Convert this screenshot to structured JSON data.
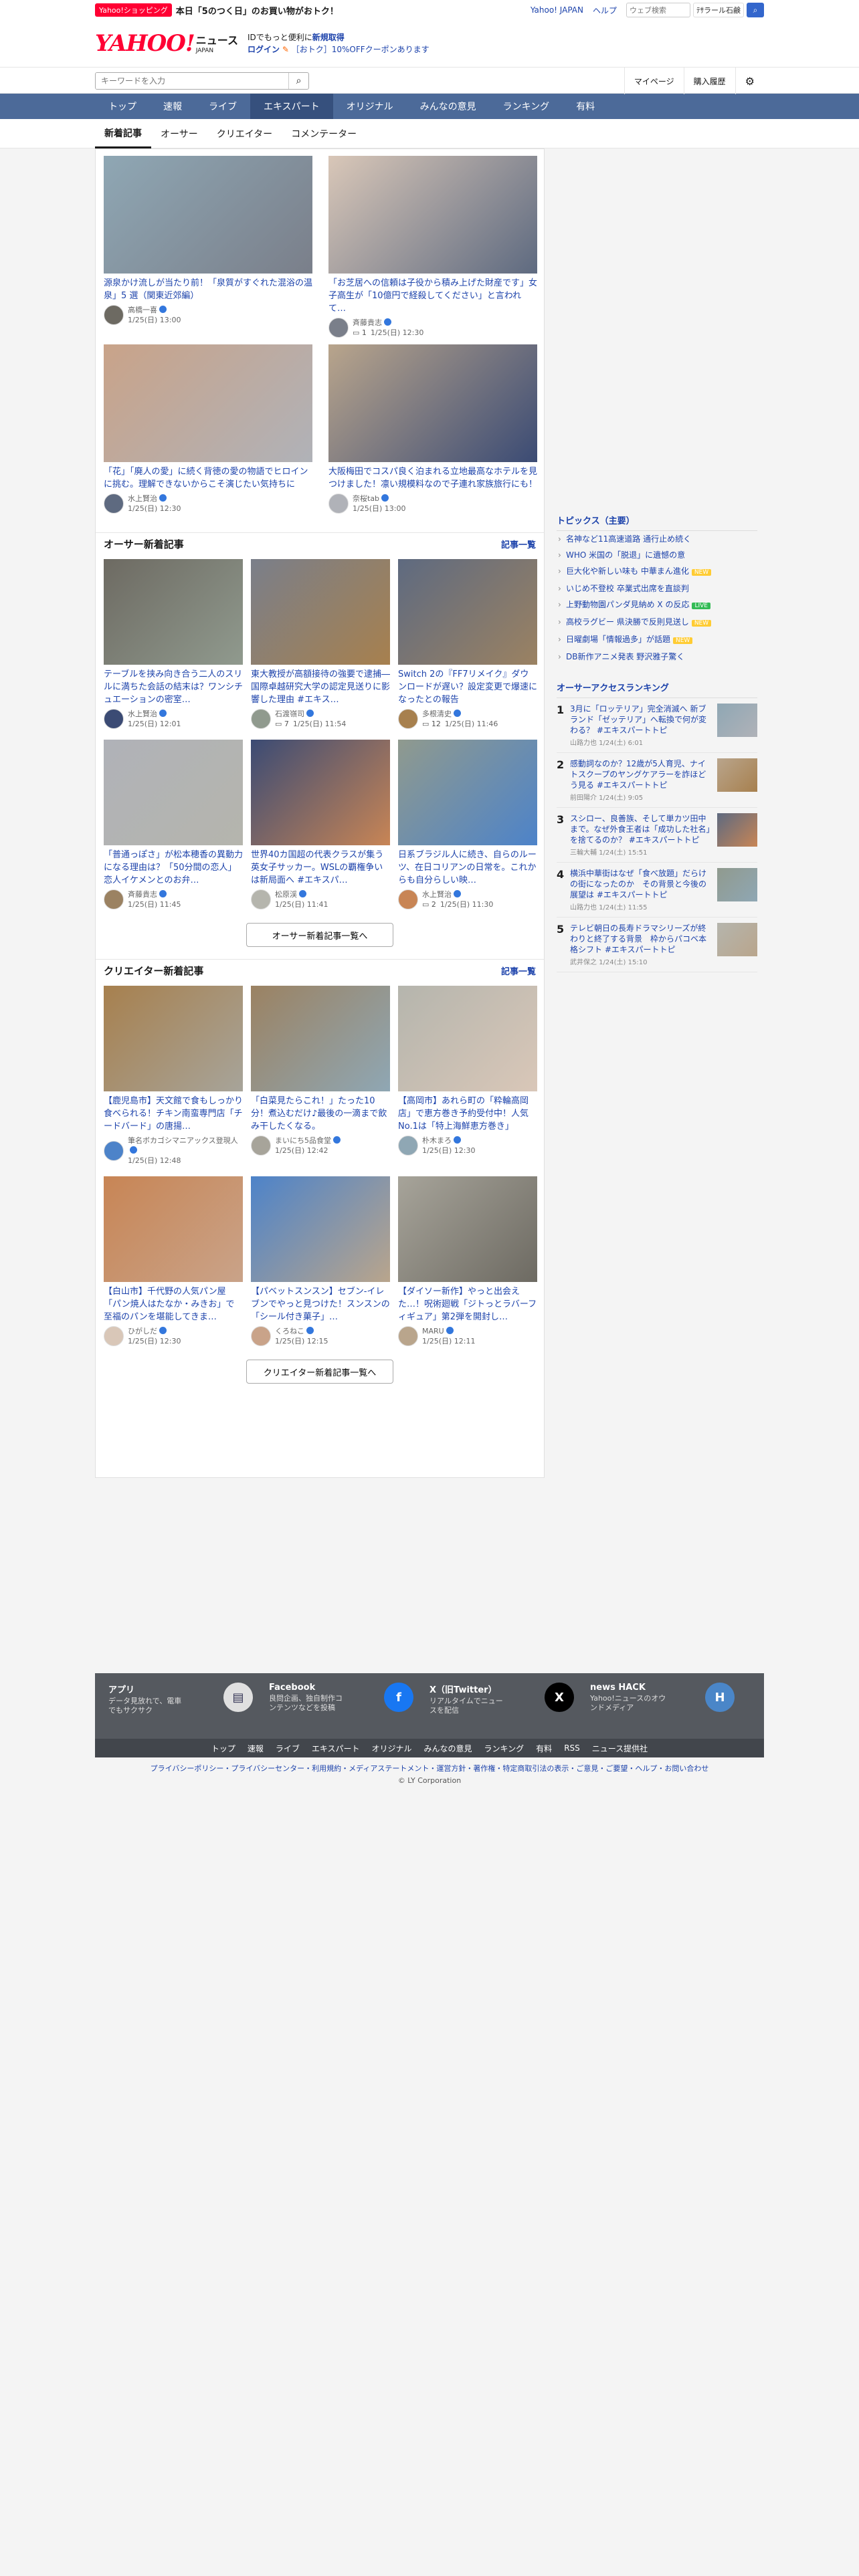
{
  "topstrip": {
    "shop_badge": "Yahoo!ショッピング",
    "promo": "本日「5のつく日」のお買い物がおトク！",
    "yahoo_japan": "Yahoo! JAPAN",
    "help": "ヘルプ",
    "web_search_placeholder": "ウェブ検索",
    "ad_pill": "ﾃｻラール石鹸"
  },
  "header": {
    "logo_yahoo": "YAHOO!",
    "logo_news": "ニュース",
    "logo_japan": "JAPAN",
    "login_line1_prefix": "IDでもっと便利に",
    "login_line1_link": "新規取得",
    "login_link": "ログイン",
    "login_line2": "［おトク］10%OFFクーポンあります"
  },
  "search": {
    "placeholder": "キーワードを入力",
    "mypage": "マイページ",
    "history": "購入履歴"
  },
  "nav": [
    "トップ",
    "速報",
    "ライブ",
    "エキスパート",
    "オリジナル",
    "みんなの意見",
    "ランキング",
    "有料"
  ],
  "nav_active": "エキスパート",
  "subtabs": [
    "新着記事",
    "オーサー",
    "クリエイター",
    "コメンテーター"
  ],
  "top_articles": [
    {
      "title": "源泉かけ流しが当たり前！「泉質がすぐれた混浴の温泉」5 選（関東近郊編）",
      "author": "高橋一喜",
      "date": "1/25(日) 13:00",
      "comments": ""
    },
    {
      "title": "「お芝居への信頼は子役から積み上げた財産です」女子高生が「10億円で経殺してください」と言われて…",
      "author": "斉藤貴志",
      "date": "1/25(日) 12:30",
      "comments": "1"
    },
    {
      "title": "「花」「廃人の愛」に続く背徳の愛の物語でヒロインに挑む。理解できないからこそ演じたい気持ちに",
      "author": "水上賢治",
      "date": "1/25(日) 12:30",
      "comments": ""
    },
    {
      "title": "大阪梅田でコスパ良く泊まれる立地最高なホテルを見つけました！凛い規模料なので子連れ家族旅行にも！",
      "author": "奈桜tab",
      "date": "1/25(日) 13:00",
      "comments": ""
    }
  ],
  "author_section": {
    "title": "オーサー新着記事",
    "link": "記事一覧",
    "more": "オーサー新着記事一覧へ",
    "articles": [
      {
        "title": "テーブルを挟み向き合う二人のスリルに満ちた会話の結末は？ワンシチュエーションの密室…",
        "author": "水上賢治",
        "date": "1/25(日) 12:01",
        "comments": ""
      },
      {
        "title": "東大教授が高額接待の強要で逮捕―国際卓越研究大学の認定見送りに影響した理由 #エキス…",
        "author": "石渡嶺司",
        "date": "1/25(日) 11:54",
        "comments": "7"
      },
      {
        "title": "Switch 2の『FF7リメイク』ダウンロードが遅い？設定変更で爆速になったとの報告",
        "author": "多根清史",
        "date": "1/25(日) 11:46",
        "comments": "12"
      },
      {
        "title": "「普通っぽさ」が松本穂香の異動力になる理由は？「50分間の恋人」恋人イケメンとのお弁…",
        "author": "斉藤貴志",
        "date": "1/25(日) 11:45",
        "comments": ""
      },
      {
        "title": "世界40カ国超の代表クラスが集う英女子サッカー。WSLの覇権争いは新局面へ #エキスパ…",
        "author": "松原渓",
        "date": "1/25(日) 11:41",
        "comments": ""
      },
      {
        "title": "日系ブラジル人に続き、自らのルーツ、在日コリアンの日常を。これからも自分らしい映…",
        "author": "水上賢治",
        "date": "1/25(日) 11:30",
        "comments": "2"
      }
    ]
  },
  "creator_section": {
    "title": "クリエイター新着記事",
    "link": "記事一覧",
    "more": "クリエイター新着記事一覧へ",
    "articles": [
      {
        "title": "【鹿児島市】天文館で食もしっかり食べられる！チキン南蛮専門店「チードバード」の唐揚…",
        "author": "筆名ボカゴシマニアックス登現人",
        "date": "1/25(日) 12:48",
        "comments": ""
      },
      {
        "title": "「白菜見たらこれ！」たった10分！煮込むだけ♪最後の一滴まで飲み干したくなる。",
        "author": "まいにち5品食堂",
        "date": "1/25(日) 12:42",
        "comments": ""
      },
      {
        "title": "【高岡市】あれら町の「粋輪高岡店」で恵方巻き予約受付中！人気No.1は「特上海鮮恵方巻き」",
        "author": "朴木まろ",
        "date": "1/25(日) 12:30",
        "comments": ""
      },
      {
        "title": "【白山市】千代野の人気パン屋「パン焼人はたなか・みきお」で至福のパンを堪能してきま…",
        "author": "ひがしだ",
        "date": "1/25(日) 12:30",
        "comments": ""
      },
      {
        "title": "【パベットスンスン】セブン-イレブンでやっと見つけた！スンスンの「シール付き菓子」…",
        "author": "くろねこ",
        "date": "1/25(日) 12:15",
        "comments": ""
      },
      {
        "title": "【ダイソー新作】やっと出会えた…！呪術廻戦「ジトっとラバーフィギュア」第2弾を開封し…",
        "author": "MARU",
        "date": "1/25(日) 12:11",
        "comments": ""
      }
    ]
  },
  "topics": {
    "title": "トピックス（主要）",
    "items": [
      {
        "text": "名神など11高速道路 通行止め続く",
        "tag": ""
      },
      {
        "text": "WHO 米国の「脱退」に遺憾の意",
        "tag": ""
      },
      {
        "text": "巨大化や新しい味も 中華まん進化",
        "tag": "NEW"
      },
      {
        "text": "いじめ不登校 卒業式出席を直談判",
        "tag": ""
      },
      {
        "text": "上野動物園パンダ見納め X の反応",
        "tag": "LIVE"
      },
      {
        "text": "高校ラグビー 県決勝で反則見送し",
        "tag": "NEW"
      },
      {
        "text": "日曜劇場「情報過多」が話題",
        "tag": "NEW"
      },
      {
        "text": "DB新作アニメ発表 野沢雅子驚く",
        "tag": ""
      }
    ]
  },
  "ranking": {
    "title": "オーサーアクセスランキング",
    "items": [
      {
        "num": "1",
        "title": "3月に「ロッテリア」完全消滅へ 新ブランド「ゼッテリア」へ転換で何が変わる？ #エキスパートトピ",
        "meta": "山路力也 1/24(土) 6:01"
      },
      {
        "num": "2",
        "title": "感動詞なのか？12歳が5人育児、ナイトスクープのヤングケアラーを詐ほど う見る #エキスパートトピ",
        "meta": "前田陽介 1/24(土) 9:05"
      },
      {
        "num": "3",
        "title": "スシロー、良善族、そして単カツ田中まで。なぜ外食王者は「成功した社名」を捨てるのか？ #エキスパートトピ",
        "meta": "三輪大輔 1/24(土) 15:51"
      },
      {
        "num": "4",
        "title": "横浜中華街はなぜ「食べ放題」だらけの街になったのか　その背景と今後の展望は #エキスパートトピ",
        "meta": "山路力也 1/24(土) 11:55"
      },
      {
        "num": "5",
        "title": "テレビ朝日の長寿ドラマシリーズが終わりと終了する背景　枠からパコベ本格シフト #エキスパートトピ",
        "meta": "武井保之 1/24(土) 15:10"
      }
    ]
  },
  "footer": {
    "cols": [
      {
        "title": "アプリ",
        "desc": "データ見放れで、電車でもサクサク",
        "icon": "app-icon",
        "glyph": "▤"
      },
      {
        "title": "Facebook",
        "desc": "良問企画、独自制作コンテンツなどを投稿",
        "icon": "facebook-icon",
        "glyph": "f"
      },
      {
        "title": "X（旧Twitter）",
        "desc": "リアルタイムでニュースを配信",
        "icon": "x-icon",
        "glyph": "X"
      },
      {
        "title": "news HACK",
        "desc": "Yahoo!ニュースのオウンドメディア",
        "icon": "newshack-icon",
        "glyph": "H"
      }
    ],
    "nav": [
      "トップ",
      "速報",
      "ライブ",
      "エキスパート",
      "オリジナル",
      "みんなの意見",
      "ランキング",
      "有料",
      "RSS",
      "ニュース提供社"
    ],
    "legal_links": "プライバシーポリシー・プライバシーセンター・利用規約・メディアステートメント・運営方針・著作権・特定商取引法の表示・ご意見・ご要望・ヘルプ・お問い合わせ",
    "copyright": "© LY Corporation"
  },
  "colors": {
    "accent": "#ff0033",
    "nav": "#4c6a99",
    "link": "#1d43ab",
    "footer": "#55595f"
  }
}
